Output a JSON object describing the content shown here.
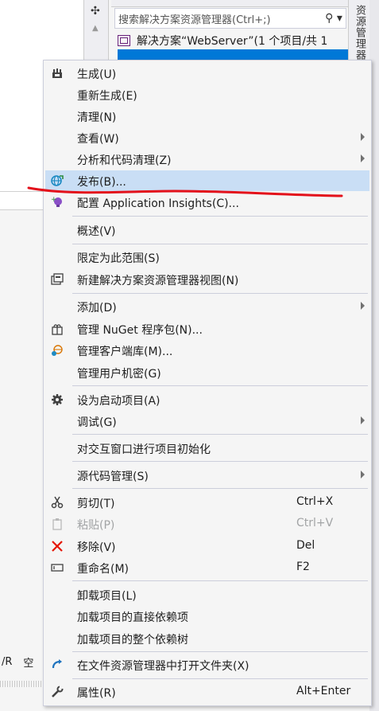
{
  "background": {
    "search_placeholder": "搜索解决方案资源管理器(Ctrl+;)",
    "solution_row": "解决方案“WebServer”(1 个项目/共 1",
    "side_tab_label": "资源管理器",
    "bottom_text_1": "/R",
    "bottom_text_2": "空"
  },
  "menu": {
    "items": [
      {
        "label": "生成(U)",
        "icon": "build-icon",
        "shortcut": "",
        "submenu": false
      },
      {
        "label": "重新生成(E)",
        "icon": "",
        "shortcut": "",
        "submenu": false
      },
      {
        "label": "清理(N)",
        "icon": "",
        "shortcut": "",
        "submenu": false
      },
      {
        "label": "查看(W)",
        "icon": "",
        "shortcut": "",
        "submenu": true
      },
      {
        "label": "分析和代码清理(Z)",
        "icon": "",
        "shortcut": "",
        "submenu": true
      },
      {
        "label": "发布(B)...",
        "icon": "publish-globe-icon",
        "shortcut": "",
        "submenu": false,
        "highlighted": true
      },
      {
        "label": "配置 Application Insights(C)...",
        "icon": "application-insights-icon",
        "shortcut": "",
        "submenu": false
      },
      {
        "label": "概述(V)",
        "icon": "",
        "shortcut": "",
        "submenu": false
      },
      {
        "label": "限定为此范围(S)",
        "icon": "",
        "shortcut": "",
        "submenu": false
      },
      {
        "label": "新建解决方案资源管理器视图(N)",
        "icon": "new-view-icon",
        "shortcut": "",
        "submenu": false
      },
      {
        "label": "添加(D)",
        "icon": "",
        "shortcut": "",
        "submenu": true
      },
      {
        "label": "管理 NuGet 程序包(N)...",
        "icon": "nuget-package-icon",
        "shortcut": "",
        "submenu": false
      },
      {
        "label": "管理客户端库(M)...",
        "icon": "client-library-icon",
        "shortcut": "",
        "submenu": false
      },
      {
        "label": "管理用户机密(G)",
        "icon": "",
        "shortcut": "",
        "submenu": false
      },
      {
        "label": "设为启动项目(A)",
        "icon": "gear-icon",
        "shortcut": "",
        "submenu": false
      },
      {
        "label": "调试(G)",
        "icon": "",
        "shortcut": "",
        "submenu": true
      },
      {
        "label": "对交互窗口进行项目初始化",
        "icon": "",
        "shortcut": "",
        "submenu": false
      },
      {
        "label": "源代码管理(S)",
        "icon": "",
        "shortcut": "",
        "submenu": true
      },
      {
        "label": "剪切(T)",
        "icon": "scissors-icon",
        "shortcut": "Ctrl+X",
        "submenu": false
      },
      {
        "label": "粘贴(P)",
        "icon": "clipboard-icon",
        "shortcut": "Ctrl+V",
        "submenu": false,
        "disabled": true
      },
      {
        "label": "移除(V)",
        "icon": "remove-x-icon",
        "shortcut": "Del",
        "submenu": false
      },
      {
        "label": "重命名(M)",
        "icon": "rename-icon",
        "shortcut": "F2",
        "submenu": false
      },
      {
        "label": "卸载项目(L)",
        "icon": "",
        "shortcut": "",
        "submenu": false
      },
      {
        "label": "加载项目的直接依赖项",
        "icon": "",
        "shortcut": "",
        "submenu": false
      },
      {
        "label": "加载项目的整个依赖树",
        "icon": "",
        "shortcut": "",
        "submenu": false
      },
      {
        "label": "在文件资源管理器中打开文件夹(X)",
        "icon": "open-folder-arrow-icon",
        "shortcut": "",
        "submenu": false
      },
      {
        "label": "属性(R)",
        "icon": "wrench-icon",
        "shortcut": "Alt+Enter",
        "submenu": false
      }
    ]
  },
  "colors": {
    "highlight": "#c9def5",
    "selection": "#0078d7",
    "annotation_line": "#e3111b",
    "disabled_text": "#a2a4a5"
  }
}
